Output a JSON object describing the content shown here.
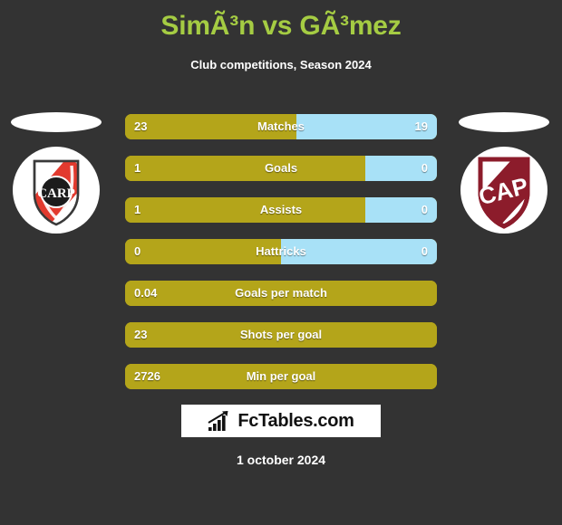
{
  "header": {
    "title": "SimÃ³n vs GÃ³mez",
    "subtitle": "Club competitions, Season 2024"
  },
  "crests": {
    "home": {
      "name": "river-plate-crest",
      "monogram": "CARP",
      "colors": {
        "sash": "#E23A2E",
        "outline": "#3A3A3A",
        "field": "#FFFFFF"
      }
    },
    "away": {
      "name": "club-atletico-platense-crest",
      "monogram": "CAP",
      "colors": {
        "shield": "#8C1C2B",
        "field": "#FFFFFF"
      }
    }
  },
  "colors": {
    "background": "#333333",
    "title": "#A5CC43",
    "home_bar": "#B4A51A",
    "away_bar": "#A8E1F7",
    "text": "#FFFFFF"
  },
  "chart_data": {
    "type": "bar",
    "title": "SimÃ³n vs GÃ³mez",
    "subtitle": "Club competitions, Season 2024",
    "orientation": "horizontal-diverging",
    "series": [
      {
        "name": "home",
        "color": "#B4A51A"
      },
      {
        "name": "away",
        "color": "#A8E1F7"
      }
    ],
    "rows": [
      {
        "label": "Matches",
        "home": "23",
        "away": "19",
        "home_pct": 54.8,
        "split": true
      },
      {
        "label": "Goals",
        "home": "1",
        "away": "0",
        "home_pct": 77.0,
        "split": true
      },
      {
        "label": "Assists",
        "home": "1",
        "away": "0",
        "home_pct": 77.0,
        "split": true
      },
      {
        "label": "Hattricks",
        "home": "0",
        "away": "0",
        "home_pct": 50.0,
        "split": true
      },
      {
        "label": "Goals per match",
        "home": "0.04",
        "away": "",
        "home_pct": 100,
        "split": false
      },
      {
        "label": "Shots per goal",
        "home": "23",
        "away": "",
        "home_pct": 100,
        "split": false
      },
      {
        "label": "Min per goal",
        "home": "2726",
        "away": "",
        "home_pct": 100,
        "split": false
      }
    ]
  },
  "footer": {
    "brand": "FcTables.com",
    "brand_icon": "bar-chart-icon",
    "date": "1 october 2024"
  }
}
